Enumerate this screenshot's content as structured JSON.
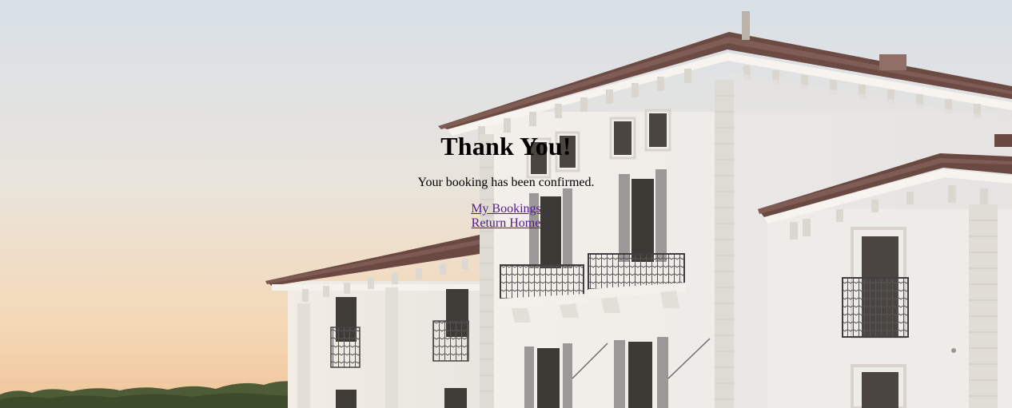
{
  "page": {
    "title": "Thank You!",
    "message": "Your booking has been confirmed.",
    "links": [
      {
        "label": "My Bookings"
      },
      {
        "label": "Return Home"
      }
    ]
  },
  "colors": {
    "text": "#000000",
    "visited_link": "#551a8b",
    "sky_top": "#dde3ea",
    "sky_bottom": "#f3c99b",
    "facade": "#efedea",
    "roof": "#6b4a44",
    "shutter": "#9a9896",
    "trees": "#4b5b33"
  },
  "background": {
    "subject": "white villa with terracotta roof at sunset"
  }
}
